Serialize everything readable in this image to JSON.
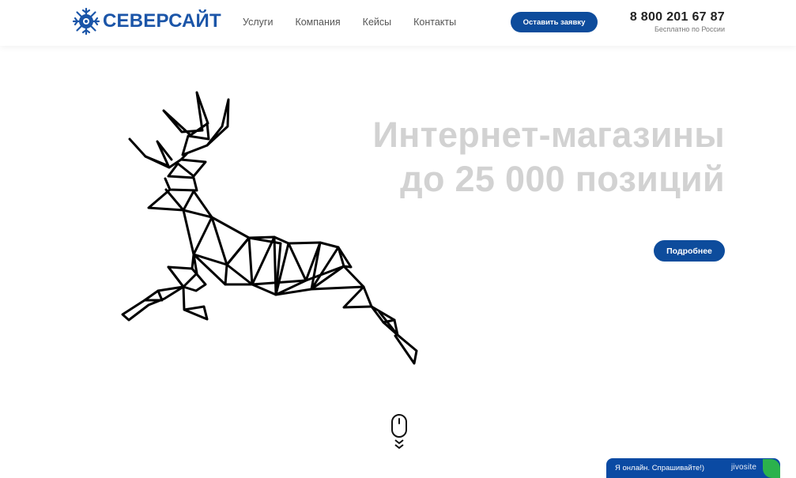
{
  "header": {
    "logo_text": "СЕВЕРСАЙТ",
    "logo_icon": "snowflake-circle-icon",
    "nav": [
      "Услуги",
      "Компания",
      "Кейсы",
      "Контакты"
    ],
    "cta_label": "Оставить заявку",
    "phone": "8 800 201 67 87",
    "phone_note": "Бесплатно по России"
  },
  "hero": {
    "title_line1": "Интернет-магазины",
    "title_line2": "до 25 000 позиций",
    "button_label": "Подробнее",
    "illustration": "polygonal-deer-illustration",
    "scroll_icon": "mouse-scroll-icon"
  },
  "chat": {
    "text": "Я онлайн. Спрашивайте!)",
    "brand": "jivosite"
  },
  "colors": {
    "accent": "#0d4c9c",
    "logo": "#1b55a8",
    "hero_title": "#d2d2d2",
    "chat_bg": "#0a4aa3",
    "chat_leaf": "#2bb24c"
  }
}
